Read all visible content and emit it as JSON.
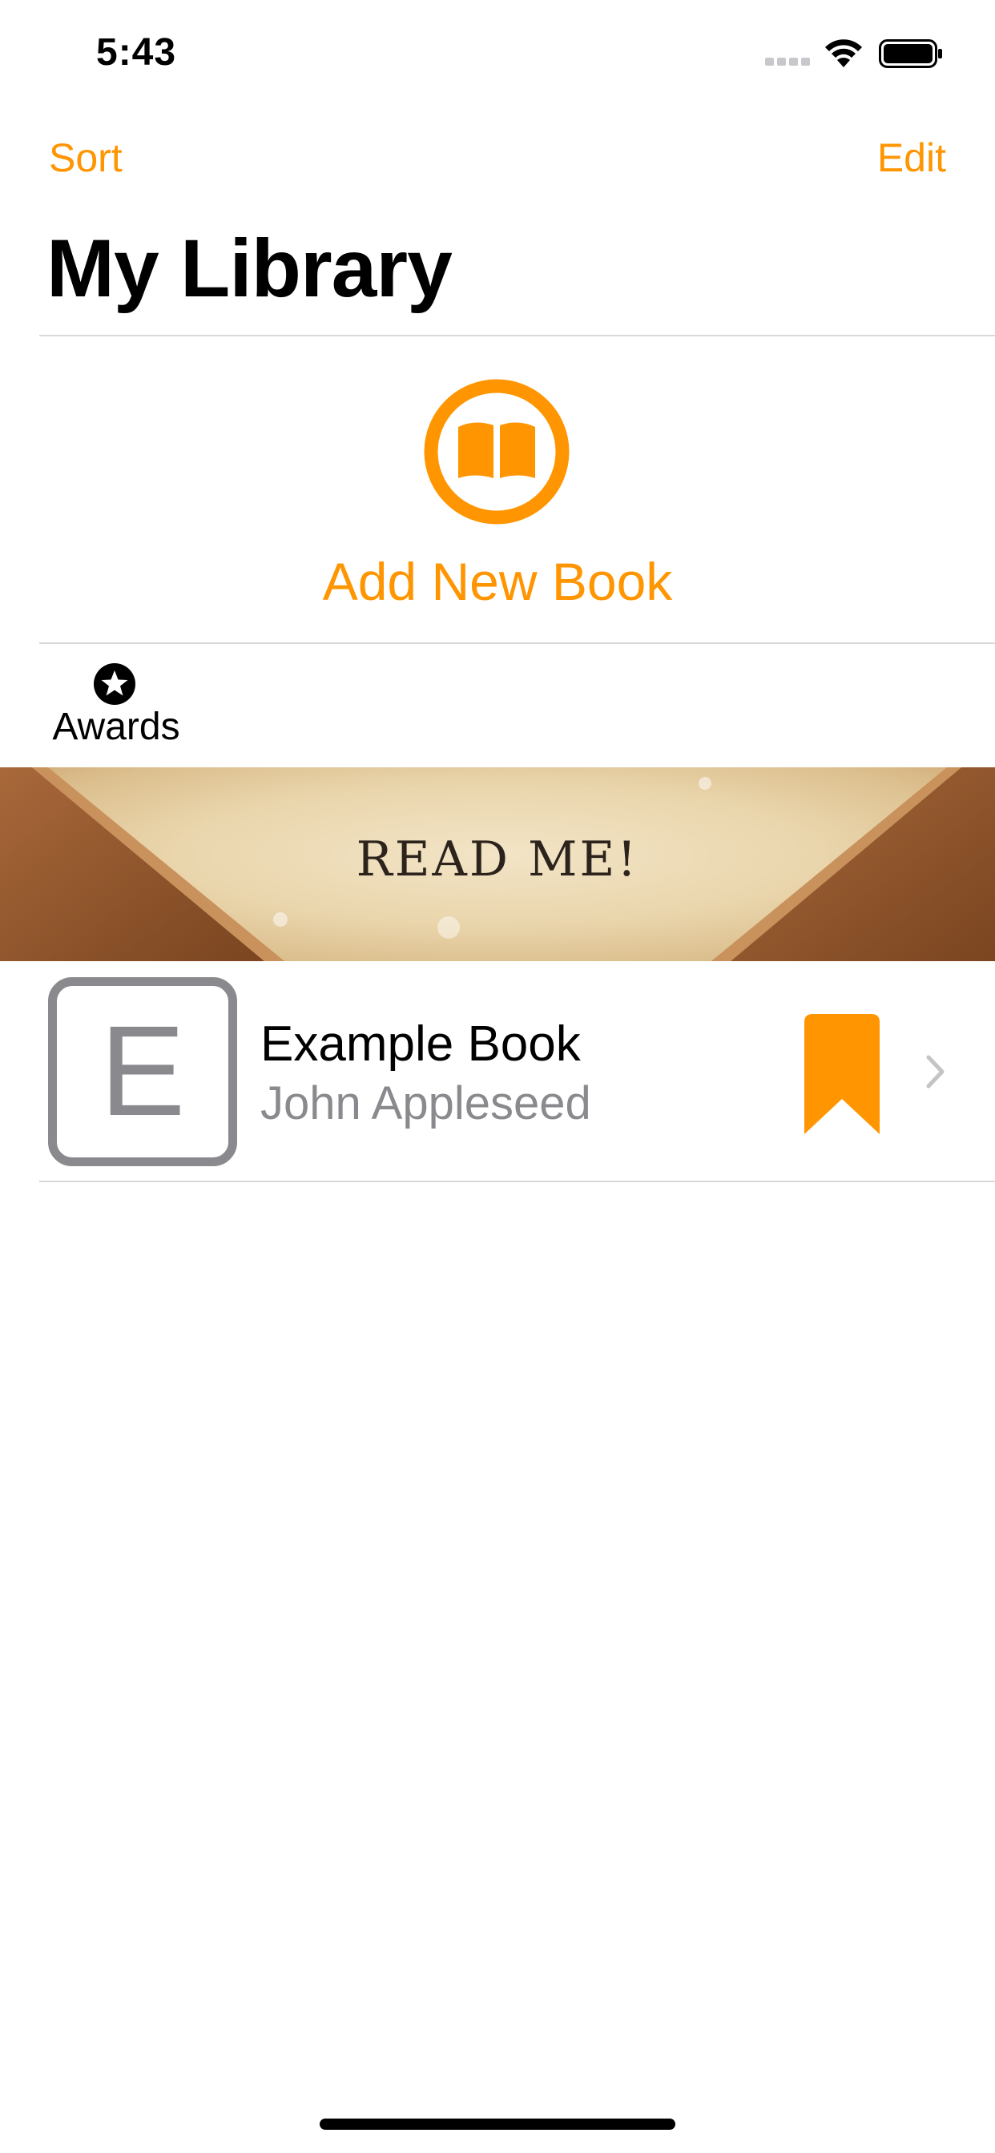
{
  "status_bar": {
    "time": "5:43",
    "icons": [
      "signal-icon",
      "wifi-icon",
      "battery-icon"
    ]
  },
  "nav": {
    "sort_label": "Sort",
    "edit_label": "Edit",
    "title": "My Library"
  },
  "add_book": {
    "icon": "book-open-icon",
    "label": "Add New Book"
  },
  "awards": {
    "icon": "star-icon",
    "label": "Awards"
  },
  "banner": {
    "text": "READ ME!"
  },
  "books": [
    {
      "cover_letter": "E",
      "title": "Example Book",
      "author": "John Appleseed",
      "bookmarked": true,
      "icons": [
        "bookmark-icon",
        "chevron-right-icon"
      ]
    }
  ],
  "colors": {
    "accent": "#ff9500",
    "secondary_text": "#8a8a8e",
    "separator": "#d9d9dc"
  }
}
